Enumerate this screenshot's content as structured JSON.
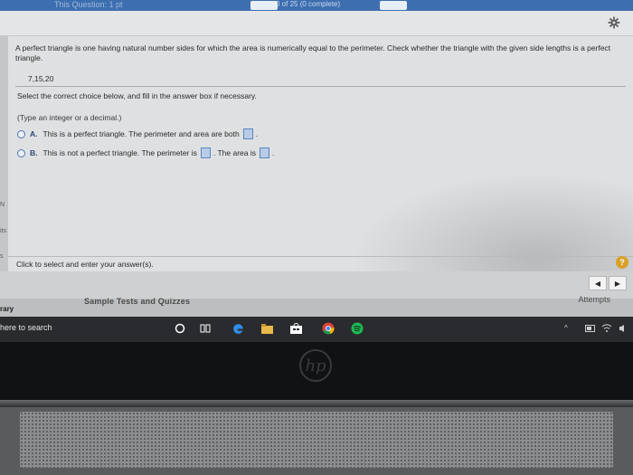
{
  "header": {
    "question_label": "This Question: 1 pt",
    "progress_label": "0 of 25 (0 complete)"
  },
  "left_strip": [
    "N",
    "its",
    "s",
    "ss"
  ],
  "question": {
    "text": "A perfect triangle is one having natural number sides for which the area is numerically equal to the perimeter. Check whether the triangle with the given side lengths is a perfect triangle.",
    "sides": "7,15,20"
  },
  "instruction": "Select the correct choice below, and fill in the answer box if necessary.",
  "hint": "(Type an integer or a decimal.)",
  "choices": [
    {
      "letter": "A.",
      "text": "This is a perfect triangle. The perimeter and area are both",
      "suffix": "."
    },
    {
      "letter": "B.",
      "text": "This is not a perfect triangle. The perimeter is",
      "mid": ". The area is",
      "suffix": "."
    }
  ],
  "footer": {
    "click_prompt": "Click to select and enter your answer(s).",
    "help_label": "?",
    "prev_label": "◀",
    "next_label": "▶",
    "sample_tests": "Sample Tests and Quizzes",
    "attempts": "Attempts",
    "library": "rary"
  },
  "taskbar": {
    "search_label": "here to search",
    "tray_up": "^",
    "icons": [
      "cortana-icon",
      "task-view-icon",
      "edge-icon",
      "file-explorer-icon",
      "store-icon",
      "chrome-icon",
      "spotify-icon"
    ]
  },
  "colors": {
    "top_bar": "#3d6fb0",
    "answer_box": "#b9cce6",
    "help_badge": "#d8a12a"
  }
}
